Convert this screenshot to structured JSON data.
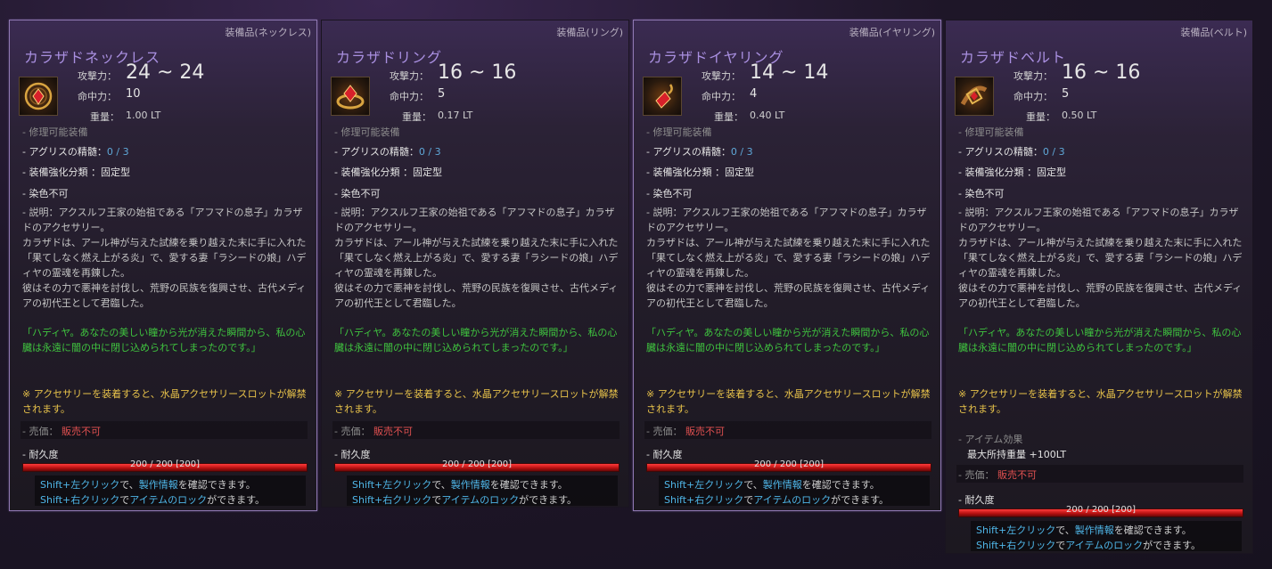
{
  "labels": {
    "attack": "攻撃力：",
    "accuracy": "命中力：",
    "weight": "重量：",
    "repairable": "- 修理可能装備",
    "agris_label": "- アグリスの精髄：",
    "agris_value": "0 / 3",
    "enhance": "- 装備強化分類 ：固定型",
    "dye": "- 染色不可",
    "price_label": "- 売価：",
    "price_value": "販売不可",
    "durability": "- 耐久度",
    "durability_value": "200 / 200 [200]",
    "effect_title": "- アイテム効果",
    "hint1_a": "Shift+左クリック",
    "hint1_b": "で、",
    "hint1_c": "製作情報",
    "hint1_d": "を確認できます。",
    "hint2_a": "Shift+右クリック",
    "hint2_b": "で",
    "hint2_c": "アイテムのロック",
    "hint2_d": "ができます。",
    "desc1": "- 説明：アクスルフ王家の始祖である「アフマドの息子」カラザドのアクセサリー。",
    "desc2": "カラザドは、アール神が与えた試練を乗り越えた末に手に入れた「果てしなく燃え上がる炎」で、愛する妻「ラシードの娘」ハディヤの霊魂を再錬した。",
    "desc3": "彼はその力で悪神を討伐し、荒野の民族を復興させ、古代メディアの初代王として君臨した。",
    "quote": "「ハディヤ。あなたの美しい瞳から光が消えた瞬間から、私の心臓は永遠に闇の中に閉じ込められてしまったのです。」",
    "note": "※ アクセサリーを装着すると、水晶アクセサリースロットが解禁されます。"
  },
  "cards": [
    {
      "category": "装備品(ネックレス)",
      "name": "カラザドネックレス",
      "attack": "24 ~ 24",
      "accuracy": "10",
      "weight": "1.00 LT",
      "icon": "necklace-icon"
    },
    {
      "category": "装備品(リング)",
      "name": "カラザドリング",
      "attack": "16 ~ 16",
      "accuracy": "5",
      "weight": "0.17 LT",
      "icon": "ring-icon"
    },
    {
      "category": "装備品(イヤリング)",
      "name": "カラザドイヤリング",
      "attack": "14 ~ 14",
      "accuracy": "4",
      "weight": "0.40 LT",
      "icon": "earring-icon"
    },
    {
      "category": "装備品(ベルト)",
      "name": "カラザドベルト",
      "attack": "16 ~ 16",
      "accuracy": "5",
      "weight": "0.50 LT",
      "icon": "belt-icon",
      "effect": "最大所持重量 +100LT"
    }
  ],
  "colors": {
    "name": "#a98fe0",
    "green_text": "#3fc33f",
    "yellow_text": "#e7c24a",
    "blue_text": "#5fa8d8",
    "red_text": "#e05050",
    "durability_bar": "#d01a1a"
  }
}
